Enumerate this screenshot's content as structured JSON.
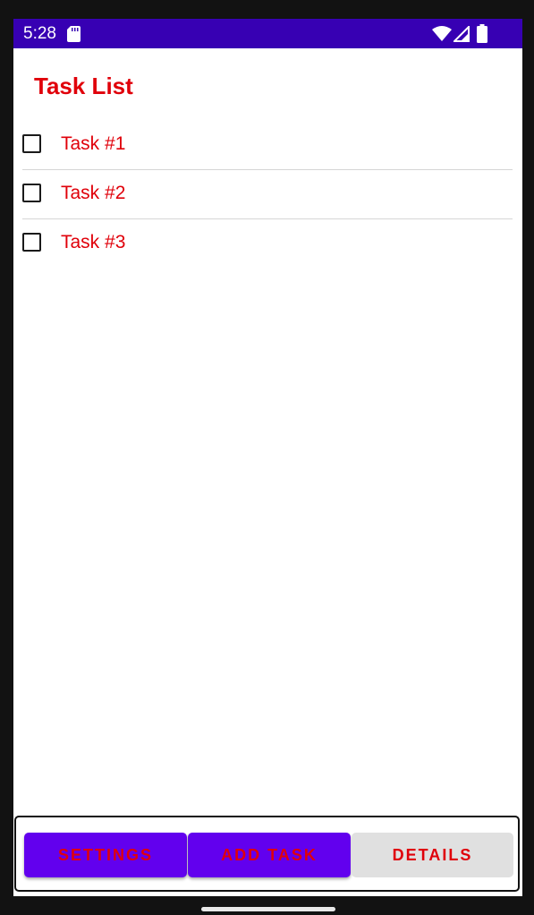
{
  "status_bar": {
    "time": "5:28",
    "icons": [
      "sd-card-icon",
      "wifi-icon",
      "signal-icon",
      "battery-icon"
    ],
    "background_color": "#3700b3"
  },
  "header": {
    "title": "Task List",
    "title_color": "#e0000a"
  },
  "tasks": [
    {
      "label": "Task #1",
      "checked": false
    },
    {
      "label": "Task #2",
      "checked": false
    },
    {
      "label": "Task #3",
      "checked": false
    }
  ],
  "bottom_bar": {
    "settings_label": "SETTINGS",
    "add_task_label": "ADD TASK",
    "details_label": "DETAILS"
  },
  "colors": {
    "accent": "#6200ee",
    "text_red": "#e0000a",
    "disabled_button": "#e0e0e0"
  }
}
